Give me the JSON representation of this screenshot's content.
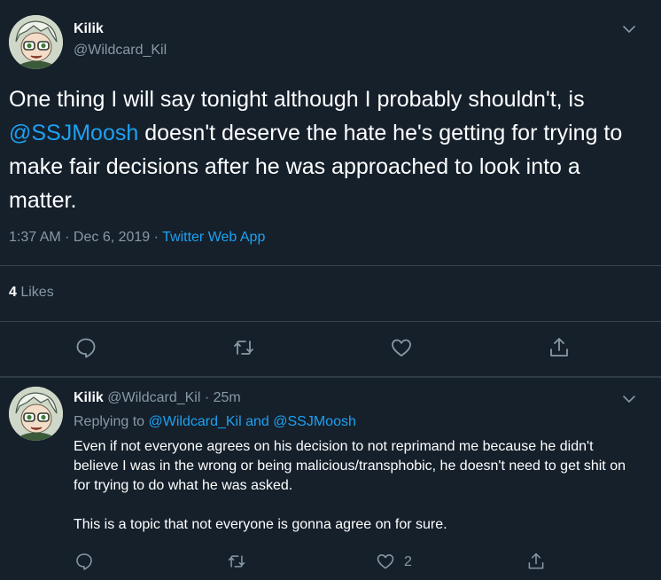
{
  "main": {
    "name": "Kilik",
    "handle": "@Wildcard_Kil",
    "text_before": "One thing I will say tonight although I probably shouldn't, is ",
    "mention": "@SSJMoosh",
    "text_after": " doesn't deserve the hate he's getting for trying to make fair decisions after he was approached to look into a matter.",
    "time": "1:37 AM · Dec 6, 2019 · ",
    "source": "Twitter Web App",
    "likes_count": "4",
    "likes_label": " Likes"
  },
  "reply": {
    "name": "Kilik",
    "handle_time": " @Wildcard_Kil · 25m",
    "replying_prefix": "Replying to ",
    "replying_user1": "@Wildcard_Kil",
    "replying_and": " and ",
    "replying_user2": "@SSJMoosh",
    "paragraph1": "Even if not everyone agrees on his decision to not reprimand me because he didn't believe I was in the wrong or being malicious/transphobic, he doesn't need to get shit on for trying to do what he was asked.",
    "paragraph2": "This is a topic that not everyone is gonna agree on for sure.",
    "like_count": "2"
  },
  "colors": {
    "background": "#15202b",
    "accent": "#1da1f2",
    "muted": "#8899a6",
    "divider": "#38444d"
  },
  "icons": {
    "avatar": "anime-avatar-icon",
    "menu": "chevron-down-icon",
    "reply": "reply-icon",
    "retweet": "retweet-icon",
    "like": "heart-icon",
    "share": "share-icon"
  }
}
